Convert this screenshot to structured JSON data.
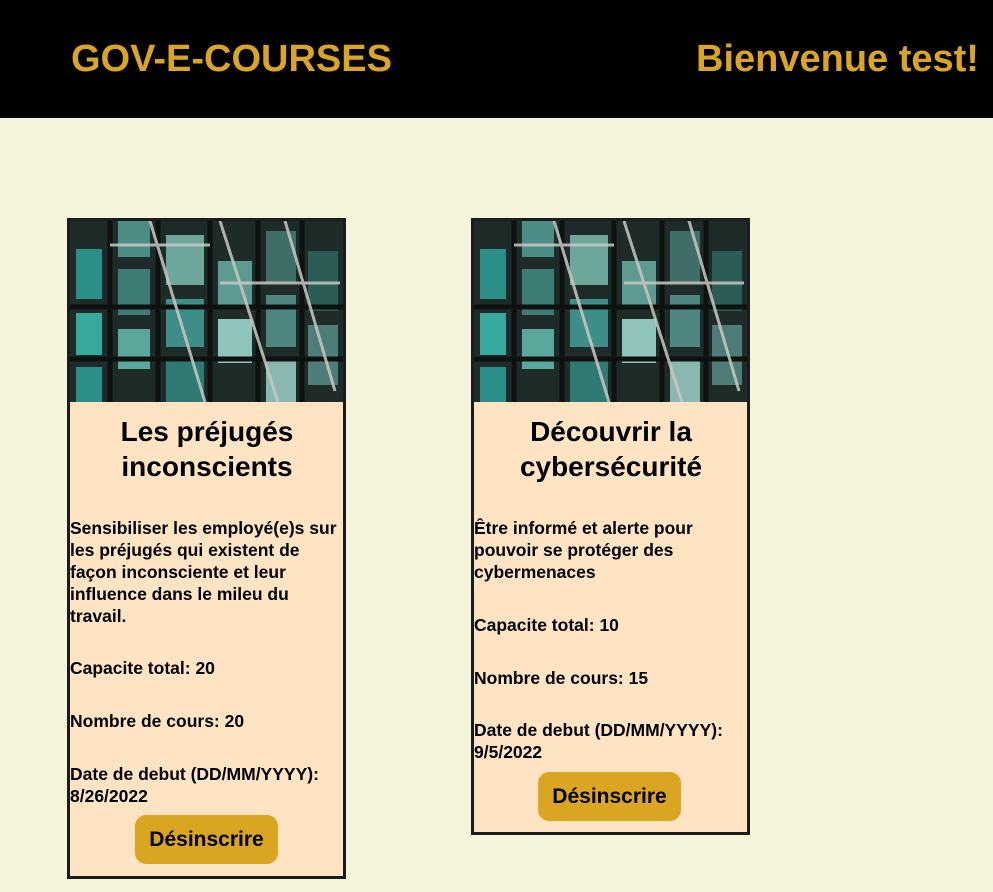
{
  "header": {
    "brand": "GOV-E-COURSES",
    "welcome": "Bienvenue test!"
  },
  "colors": {
    "header_bg": "#000000",
    "accent": "#daa520",
    "page_bg": "#f5f5dc",
    "card_bg": "#ffe4c4"
  },
  "courses": [
    {
      "image": "building-facade-image",
      "title": "Les préjugés inconscients",
      "description": "Sensibiliser les employé(e)s sur les préjugés qui existent de façon inconsciente et leur influence dans le mileu du travail.",
      "capacity": "Capacite total: 20",
      "count": "Nombre de cours: 20",
      "start": "Date de debut (DD/MM/YYYY): 8/26/2022",
      "button": "Désinscrire"
    },
    {
      "image": "building-facade-image",
      "title": "Découvrir la cybersécurité",
      "description": "Être informé et alerte pour pouvoir se protéger des cybermenaces",
      "capacity": "Capacite total: 10",
      "count": "Nombre de cours: 15",
      "start": "Date de debut (DD/MM/YYYY): 9/5/2022",
      "button": "Désinscrire"
    }
  ]
}
